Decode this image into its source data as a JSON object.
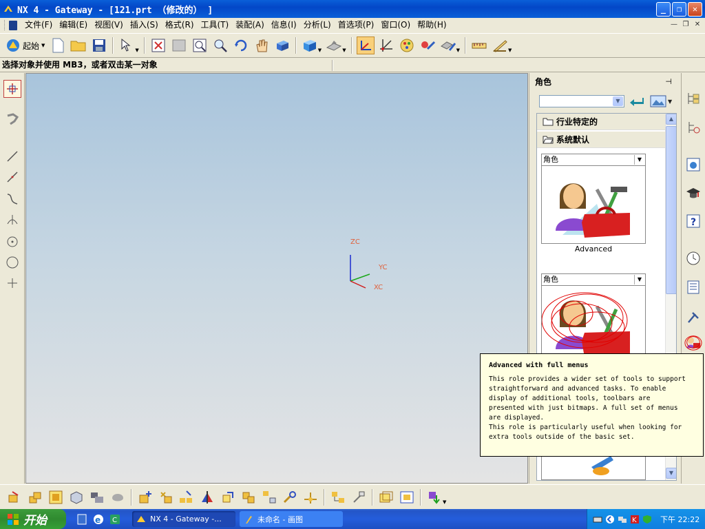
{
  "window": {
    "title": "NX 4 - Gateway - [121.prt （修改的） ]",
    "buttons": [
      "minimize",
      "restore",
      "close"
    ]
  },
  "menubar": {
    "items": [
      "文件(F)",
      "编辑(E)",
      "视图(V)",
      "插入(S)",
      "格式(R)",
      "工具(T)",
      "装配(A)",
      "信息(I)",
      "分析(L)",
      "首选项(P)",
      "窗口(O)",
      "帮助(H)"
    ]
  },
  "toolbar": {
    "start_label": "起始"
  },
  "cue_line": {
    "text": "选择对象并使用 MB3，或者双击某一对象"
  },
  "viewport": {
    "axis_labels": {
      "z": "ZC",
      "y": "YC",
      "x": "XC"
    }
  },
  "resource_bar": {
    "title": "角色",
    "folders": [
      "行业特定的",
      "系统默认"
    ],
    "cards": [
      {
        "header": "角色",
        "name": "Advanced"
      },
      {
        "header": "角色",
        "name": ""
      }
    ]
  },
  "tooltip": {
    "title": "Advanced with full menus",
    "body": "This role provides a wider set of tools to support\nstraightforward and advanced tasks. To enable\ndisplay of additional tools, toolbars are\npresented with just bitmaps. A full set of menus\nare displayed.\nThis role is particularly useful when looking for\nextra tools outside of the basic set."
  },
  "taskbar": {
    "start_label": "开始",
    "tasks": [
      {
        "label": "NX 4 - Gateway -...",
        "active": true
      },
      {
        "label": "未命名 - 画图",
        "active": false
      }
    ],
    "clock": "下午 22:22"
  },
  "colors": {
    "titlebar": "#0a5fd8",
    "axis_label": "#e0603a",
    "tooltip_bg": "#ffffe1",
    "annotation_red": "#e00000"
  }
}
